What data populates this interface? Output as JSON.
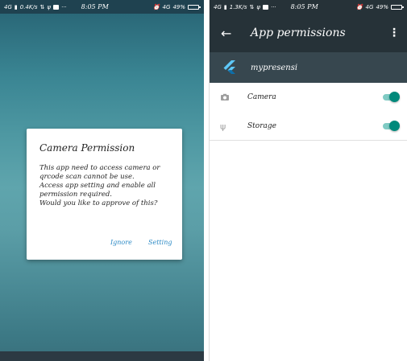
{
  "left_phone": {
    "status": {
      "network": "4G",
      "speed": "0.4K/s",
      "time": "8:05 PM",
      "net_type": "4G",
      "battery": "49%",
      "battery_level": 0.49
    },
    "dialog": {
      "title": "Camera Permission",
      "message": "This app need to access camera or\nqrcode scan cannot be use.\nAccess app setting and enable all\npermission required.\nWould you like to approve of this?",
      "ignore_label": "Ignore",
      "setting_label": "Setting"
    }
  },
  "right_phone": {
    "status": {
      "network": "4G",
      "speed": "1.3K/s",
      "time": "8:05 PM",
      "net_type": "4G",
      "battery": "49%",
      "battery_level": 0.49
    },
    "appbar": {
      "back_icon": "arrow-left-icon",
      "title": "App permissions",
      "menu_icon": "more-vert-icon"
    },
    "app": {
      "name": "mypresensi",
      "icon": "flutter-logo-icon"
    },
    "permissions": [
      {
        "label": "Camera",
        "icon": "camera-icon",
        "enabled": true
      },
      {
        "label": "Storage",
        "icon": "usb-storage-icon",
        "enabled": true
      }
    ]
  },
  "colors": {
    "appbar": "#263238",
    "app_header": "#37474f",
    "toggle_on": "#00897b",
    "toggle_track": "#80cbc4",
    "dialog_button": "#2e8bc6"
  }
}
